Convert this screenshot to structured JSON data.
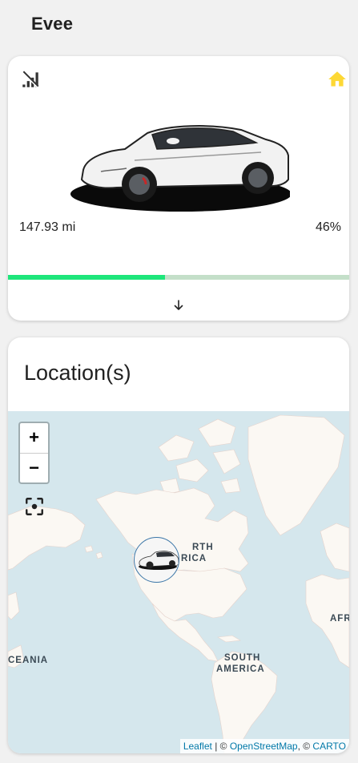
{
  "header": {
    "title": "Evee"
  },
  "vehicle_card": {
    "range": "147.93 mi",
    "battery_percent_label": "46%",
    "battery_level": 0.46,
    "colors": {
      "bar_fill": "#1ee67b",
      "bar_track": "#c4dfc9",
      "home_icon": "#fdd835"
    },
    "icons": {
      "connectivity": "signal-off-icon",
      "location": "home-icon",
      "expand": "arrow-down-icon"
    }
  },
  "location_card": {
    "title": "Location(s)",
    "map": {
      "zoom_in": "+",
      "zoom_out": "−",
      "labels": {
        "north_america": [
          "RTH",
          "RICA"
        ],
        "south_america": [
          "SOUTH",
          "AMERICA"
        ],
        "oceania": "CEANIA",
        "africa": "AFR"
      },
      "attribution": {
        "leaflet": "Leaflet",
        "separator": "| ©",
        "osm": "OpenStreetMap",
        "carto_prefix": ", ©",
        "carto": "CARTO"
      }
    }
  }
}
